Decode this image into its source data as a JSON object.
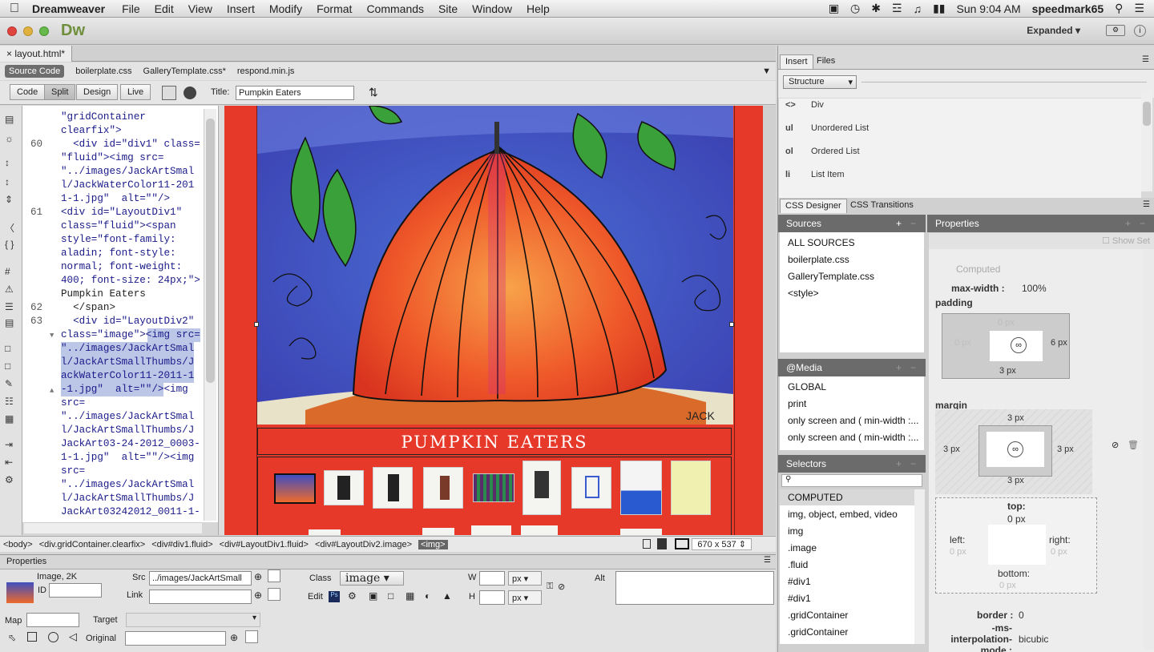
{
  "menubar": {
    "app": "Dreamweaver",
    "items": [
      "File",
      "Edit",
      "View",
      "Insert",
      "Modify",
      "Format",
      "Commands",
      "Site",
      "Window",
      "Help"
    ],
    "clock": "Sun 9:04 AM",
    "user": "speedmark65"
  },
  "titlebar": {
    "logo": "Dw",
    "workspace": "Expanded"
  },
  "doc": {
    "tab": "layout.html*",
    "related": [
      "Source Code",
      "boilerplate.css",
      "GalleryTemplate.css*",
      "respond.min.js"
    ],
    "views": [
      "Code",
      "Split",
      "Design",
      "Live"
    ],
    "title_label": "Title:",
    "title_value": "Pumpkin Eaters"
  },
  "code": {
    "line_numbers": [
      {
        "n": "60",
        "row": 2
      },
      {
        "n": "61",
        "row": 7
      },
      {
        "n": "62",
        "row": 14
      },
      {
        "n": "63",
        "row": 15
      }
    ],
    "lines": [
      "\"gridContainer",
      "clearfix\">",
      "  <div id=\"div1\" class=",
      "\"fluid\"><img src=",
      "\"../images/JackArtSmal",
      "l/JackWaterColor11-201",
      "1-1.jpg\"  alt=\"\"/>",
      "<div id=\"LayoutDiv1\"",
      "class=\"fluid\"><span",
      "style=\"font-family:",
      "aladin; font-style:",
      "normal; font-weight:",
      "400; font-size: 24px;\">",
      "Pumpkin Eaters",
      "  </span>",
      "  <div id=\"LayoutDiv2\"",
      "class=\"image\"><img src=",
      "\"../images/JackArtSmal",
      "l/JackArtSmallThumbs/J",
      "ackWaterColor11-2011-1",
      "-1.jpg\"  alt=\"\"/><img",
      "src=",
      "\"../images/JackArtSmal",
      "l/JackArtSmallThumbs/J",
      "JackArt03-24-2012_0003-",
      "1-1.jpg\"  alt=\"\"/><img",
      "src=",
      "\"../images/JackArtSmal",
      "l/JackArtSmallThumbs/J",
      "JackArt03242012_0011-1-"
    ]
  },
  "design": {
    "banner": "PUMPKIN EATERS",
    "signature": "JACK",
    "bg": "#e7392a"
  },
  "status": {
    "tags": [
      "<body>",
      "<div.gridContainer.clearfix>",
      "<div#div1.fluid>",
      "<div#LayoutDiv1.fluid>",
      "<div#LayoutDiv2.image>"
    ],
    "current": "<img>",
    "size": "670 x 537 ⇕"
  },
  "props": {
    "header": "Properties",
    "kind": "Image, 2K",
    "id_label": "ID",
    "src_label": "Src",
    "src_value": "../images/JackArtSmall",
    "link_label": "Link",
    "class_label": "Class",
    "class_value": "image",
    "edit_label": "Edit",
    "w_label": "W",
    "h_label": "H",
    "unit": "px",
    "alt_label": "Alt",
    "map_label": "Map",
    "target_label": "Target",
    "original_label": "Original"
  },
  "insert": {
    "tabs": [
      "Insert",
      "Files"
    ],
    "category": "Structure",
    "items": [
      {
        "icon": "<>",
        "label": "Div"
      },
      {
        "icon": "ul",
        "label": "Unordered List"
      },
      {
        "icon": "ol",
        "label": "Ordered List"
      },
      {
        "icon": "li",
        "label": "List Item"
      }
    ]
  },
  "css": {
    "tabs": [
      "CSS Designer",
      "CSS Transitions"
    ],
    "sources_title": "Sources",
    "sources": [
      "ALL SOURCES",
      "boilerplate.css",
      "GalleryTemplate.css",
      "<style>"
    ],
    "media_title": "@Media",
    "media": [
      "GLOBAL",
      "print",
      "only screen and ( min-width :...",
      "only screen and ( min-width :..."
    ],
    "selectors_title": "Selectors",
    "selectors": [
      "COMPUTED",
      "img, object, embed, video",
      "img",
      ".image",
      ".fluid",
      "#div1",
      "#div1",
      ".gridContainer",
      ".gridContainer"
    ],
    "props_title": "Properties",
    "show_set": "Show Set",
    "computed": "Computed",
    "max_width_label": "max-width :",
    "max_width_value": "100%",
    "padding_label": "padding",
    "pad_top": "0 px",
    "pad_left": "0 px",
    "pad_right": "6 px",
    "pad_bottom": "3 px",
    "margin_label": "margin",
    "mar_top": "3 px",
    "mar_left": "3 px",
    "mar_right": "3 px",
    "mar_bottom": "3 px",
    "pos_top_label": "top:",
    "pos_top": "0 px",
    "pos_left_label": "left:",
    "pos_left": "0 px",
    "pos_right_label": "right:",
    "pos_right": "0 px",
    "pos_bottom_label": "bottom:",
    "pos_bottom": "0 px",
    "border_label": "border :",
    "border_value": "0",
    "interp_label": "-ms-interpolation-mode :",
    "interp_value": "bicubic"
  }
}
